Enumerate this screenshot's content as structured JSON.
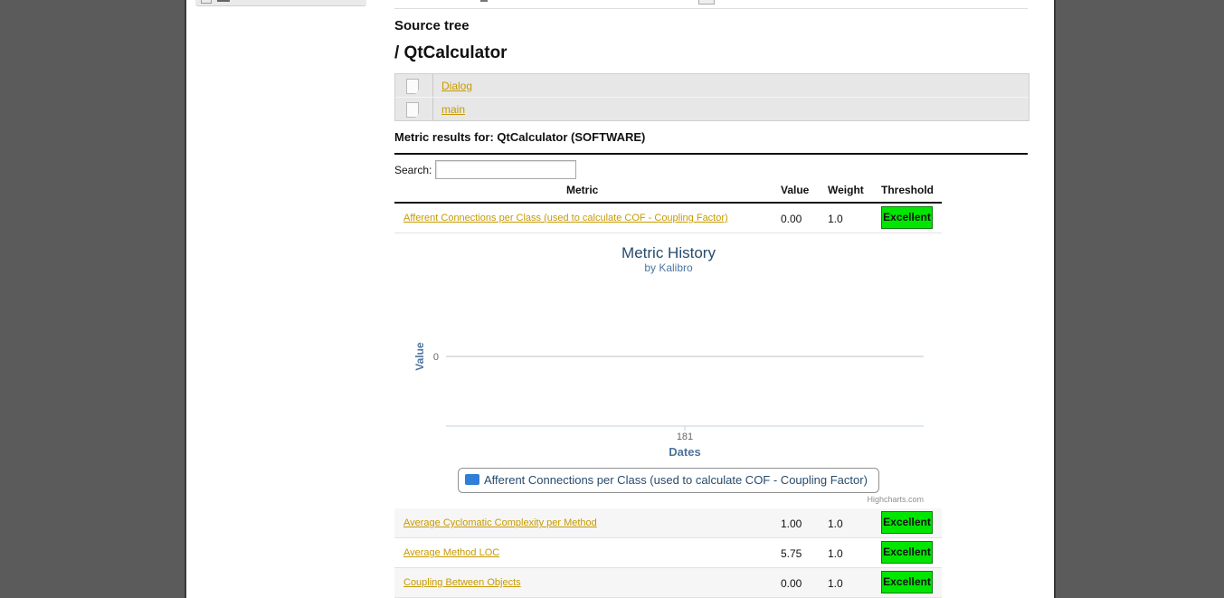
{
  "source_tree": {
    "heading": "Source tree",
    "path": "/ QtCalculator",
    "items": [
      {
        "label": "Dialog",
        "icon": "file-icon"
      },
      {
        "label": "main",
        "icon": "file-icon"
      }
    ]
  },
  "metric_results": {
    "heading": "Metric results for: QtCalculator (SOFTWARE)",
    "search_label": "Search:",
    "search_value": "",
    "columns": [
      "Metric",
      "Value",
      "Weight",
      "Threshold"
    ],
    "rows": [
      {
        "metric": "Afferent Connections per Class (used to calculate COF - Coupling Factor)",
        "value": "0.00",
        "weight": "1.0",
        "threshold": "Excellent"
      },
      {
        "metric": "Average Cyclomatic Complexity per Method",
        "value": "1.00",
        "weight": "1.0",
        "threshold": "Excellent"
      },
      {
        "metric": "Average Method LOC",
        "value": "5.75",
        "weight": "1.0",
        "threshold": "Excellent"
      },
      {
        "metric": "Coupling Between Objects",
        "value": "0.00",
        "weight": "1.0",
        "threshold": "Excellent"
      }
    ],
    "threshold_color": "#00e600"
  },
  "chart_data": {
    "type": "line",
    "title": "Metric History",
    "subtitle": "by Kalibro",
    "xlabel": "Dates",
    "ylabel": "Value",
    "x_tick_labels": [
      "181"
    ],
    "y_tick_labels": [
      "0"
    ],
    "series": [
      {
        "name": "Afferent Connections per Class (used to calculate COF - Coupling Factor)",
        "x": [
          "181"
        ],
        "values": [
          0
        ],
        "color": "#2f7ed8"
      }
    ],
    "legend_position": "bottom-center",
    "credits": "Highcharts.com",
    "grid": true
  }
}
